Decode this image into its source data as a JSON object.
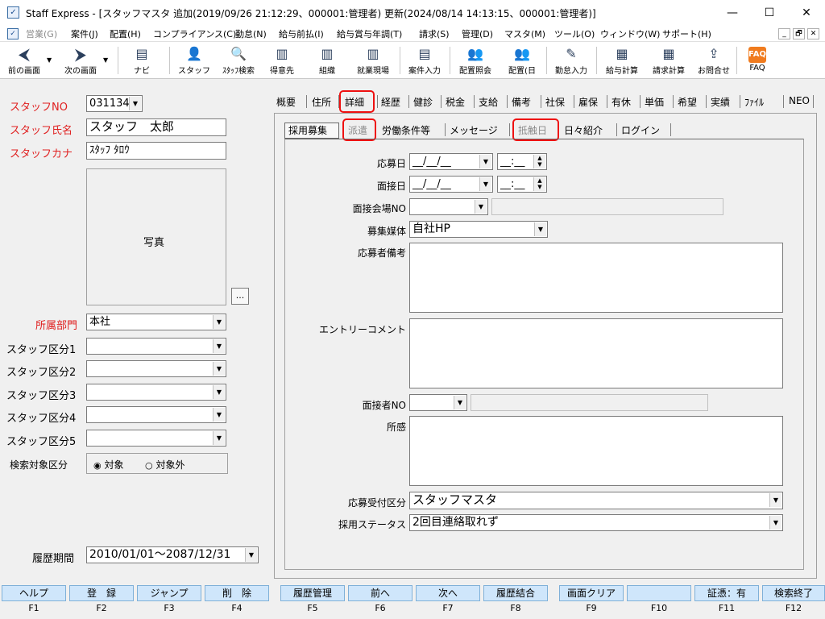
{
  "window": {
    "title": "Staff Express - [スタッフマスタ  追加(2019/09/26 21:12:29、000001:管理者)  更新(2024/08/14 14:13:15、000001:管理者)]",
    "minimize": "—",
    "maximize": "☐",
    "close": "✕"
  },
  "menu": {
    "items": [
      "営業(G)",
      "案件(J)",
      "配置(H)",
      "コンプライアンス(C)",
      "勤怠(N)",
      "給与前払(I)",
      "給与賞与年調(T)",
      "請求(S)",
      "管理(D)",
      "マスタ(M)",
      "ツール(O)",
      "ウィンドウ(W)",
      "サポート(H)"
    ],
    "mdi": [
      "_",
      "🗗",
      "✕"
    ]
  },
  "toolbar": {
    "items": [
      "前の画面",
      "次の画面",
      "ナビ",
      "スタッフ",
      "ｽﾀｯﾌ検索",
      "得意先",
      "組織",
      "就業現場",
      "案件入力",
      "配置照会",
      "配置(日",
      "勤怠入力",
      "給与計算",
      "請求計算",
      "お問合せ",
      "FAQ"
    ]
  },
  "left": {
    "staff_no_label": "スタッフNO",
    "staff_no_value": "031134",
    "staff_name_label": "スタッフ氏名",
    "staff_name_value": "スタッフ　太郎",
    "staff_kana_label": "スタッフカナ",
    "staff_kana_value": "ｽﾀｯﾌ ﾀﾛｳ",
    "photo_label": "写真",
    "browse_label": "...",
    "dept_label": "所属部門",
    "dept_value": "本社",
    "kubun1_label": "スタッフ区分1",
    "kubun2_label": "スタッフ区分2",
    "kubun3_label": "スタッフ区分3",
    "kubun4_label": "スタッフ区分4",
    "kubun5_label": "スタッフ区分5",
    "search_label": "検索対象区分",
    "radio_target": "対象",
    "radio_exclude": "対象外",
    "history_label": "履歴期間",
    "history_value": "2010/01/01～2087/12/31"
  },
  "tabs": [
    "概要",
    "住所",
    "詳細",
    "経歴",
    "健診",
    "税金",
    "支給",
    "備考",
    "社保",
    "雇保",
    "有休",
    "単価",
    "希望",
    "実績",
    "ﾌｧｲﾙ",
    "NEO"
  ],
  "subtabs": [
    "採用募集",
    "派遣",
    "労働条件等",
    "メッセージ",
    "抵触日",
    "日々紹介",
    "ログイン"
  ],
  "form": {
    "apply_date_label": "応募日",
    "date_blank": "__/__/__",
    "time_blank": "__:__",
    "interview_date_label": "面接日",
    "venue_label": "面接会場NO",
    "media_label": "募集媒体",
    "media_value": "自社HP",
    "note_label": "応募者備考",
    "entry_label": "エントリーコメント",
    "interviewer_label": "面接者NO",
    "impression_label": "所感",
    "reception_label": "応募受付区分",
    "reception_value": "スタッフマスタ",
    "status_label": "採用ステータス",
    "status_value": "2回目連絡取れず"
  },
  "fkeys": {
    "labels": [
      "ヘルプ",
      "登　録",
      "ジャンプ",
      "削　除",
      "履歴管理",
      "前へ",
      "次へ",
      "履歴結合",
      "画面クリア",
      "",
      "証憑：有",
      "検索終了"
    ],
    "keys": [
      "F1",
      "F2",
      "F3",
      "F4",
      "F5",
      "F6",
      "F7",
      "F8",
      "F9",
      "F10",
      "F11",
      "F12"
    ]
  }
}
